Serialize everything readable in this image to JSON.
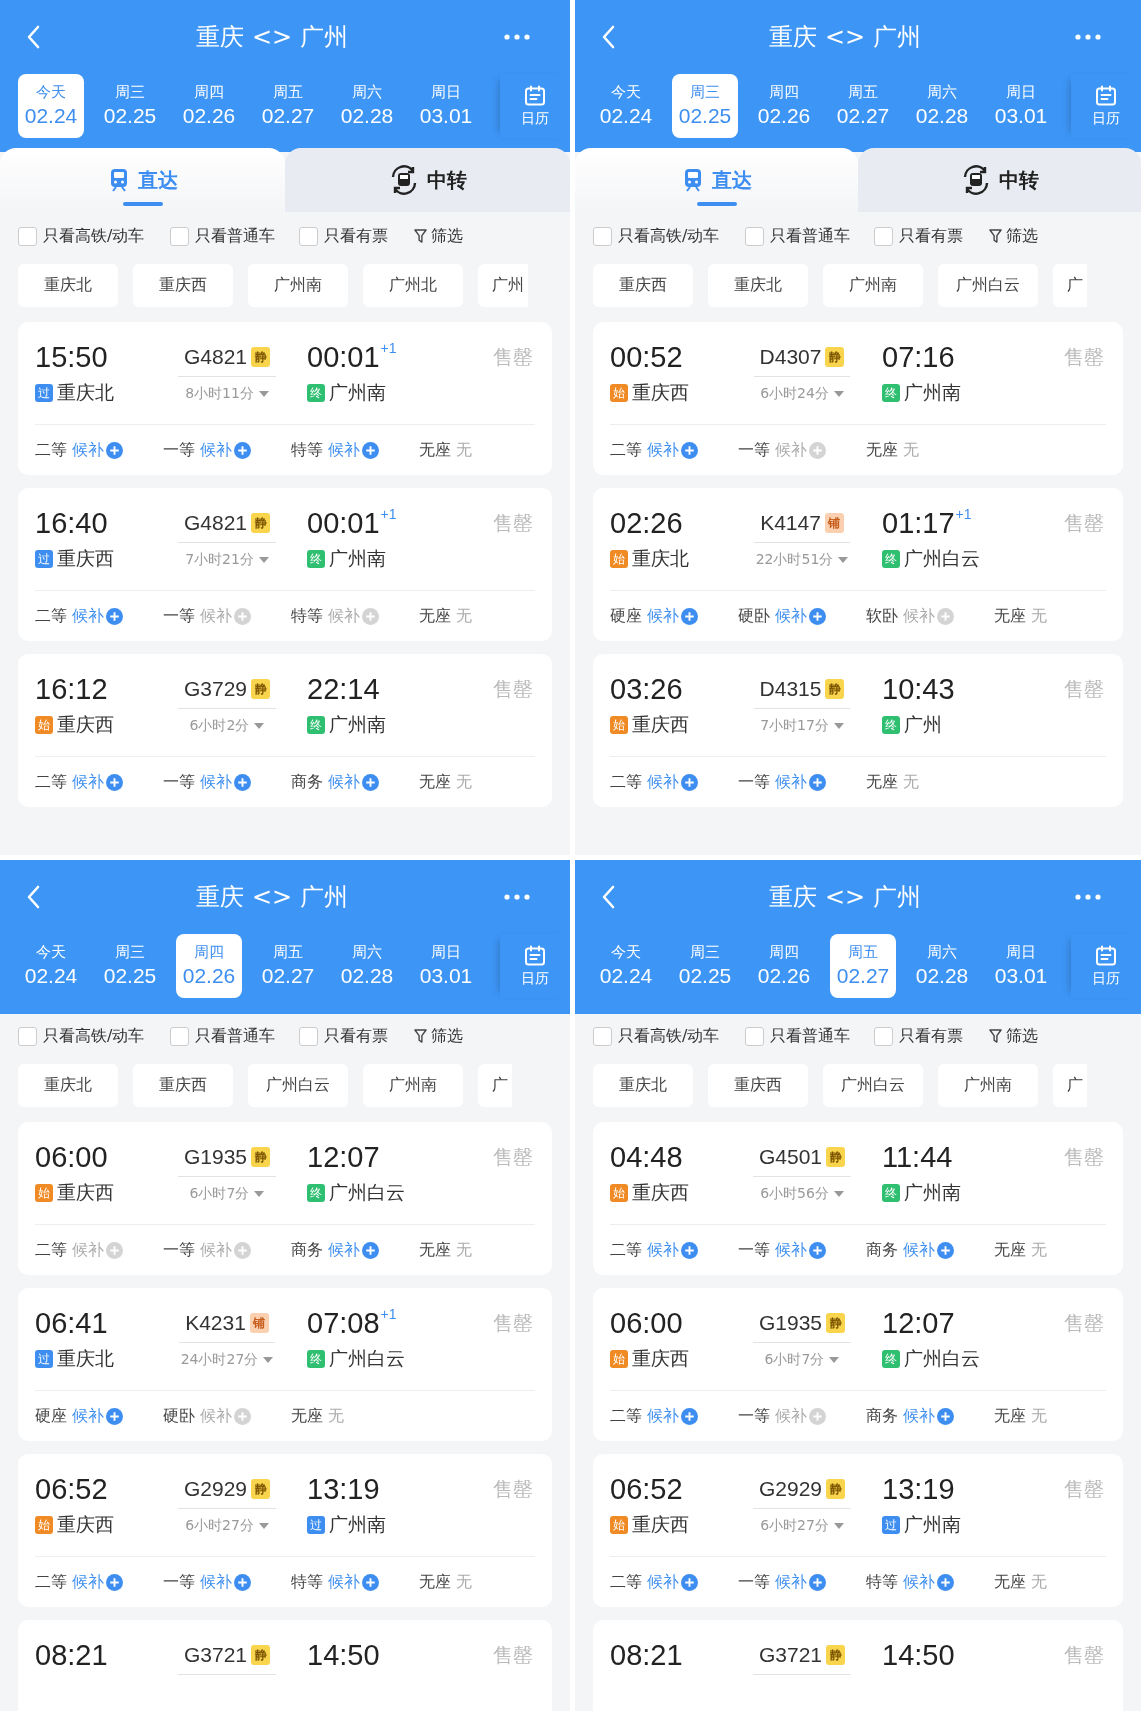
{
  "panels": [
    {
      "title": "重庆 <> 广州",
      "dates": [
        {
          "weekday": "今天",
          "date": "02.24",
          "selected": true
        },
        {
          "weekday": "周三",
          "date": "02.25",
          "selected": false
        },
        {
          "weekday": "周四",
          "date": "02.26",
          "selected": false
        },
        {
          "weekday": "周五",
          "date": "02.27",
          "selected": false
        },
        {
          "weekday": "周六",
          "date": "02.28",
          "selected": false
        },
        {
          "weekday": "周日",
          "date": "03.01",
          "selected": false
        }
      ],
      "calendar": "日历",
      "tabs": [
        {
          "label": "直达",
          "kind": "direct",
          "selected": true
        },
        {
          "label": "中转",
          "kind": "transfer",
          "selected": false
        }
      ],
      "filters": [
        {
          "label": "只看高铁/动车",
          "checked": false
        },
        {
          "label": "只看普通车",
          "checked": false
        },
        {
          "label": "只看有票",
          "checked": false
        }
      ],
      "filter_button": "筛选",
      "stations": [
        {
          "label": "重庆北"
        },
        {
          "label": "重庆西"
        },
        {
          "label": "广州南"
        },
        {
          "label": "广州北"
        },
        {
          "label": "广州",
          "cut": true
        }
      ],
      "trains": [
        {
          "depart": "15:50",
          "train": "G4821",
          "tag": {
            "text": "静",
            "kind": "quiet"
          },
          "arrive": "00:01",
          "next_day": "+1",
          "status": "售罄",
          "from": {
            "marker": "过",
            "kind": "pass",
            "name": "重庆北"
          },
          "duration": "8小时11分",
          "to": {
            "marker": "终",
            "kind": "end",
            "name": "广州南"
          },
          "seats": [
            {
              "class": "二等",
              "status": "候补",
              "kind": "waitlist",
              "available": true
            },
            {
              "class": "一等",
              "status": "候补",
              "kind": "waitlist",
              "available": true
            },
            {
              "class": "特等",
              "status": "候补",
              "kind": "waitlist",
              "available": true
            },
            {
              "class": "无座",
              "status": "无",
              "kind": "none"
            }
          ]
        },
        {
          "depart": "16:40",
          "train": "G4821",
          "tag": {
            "text": "静",
            "kind": "quiet"
          },
          "arrive": "00:01",
          "next_day": "+1",
          "status": "售罄",
          "from": {
            "marker": "过",
            "kind": "pass",
            "name": "重庆西"
          },
          "duration": "7小时21分",
          "to": {
            "marker": "终",
            "kind": "end",
            "name": "广州南"
          },
          "seats": [
            {
              "class": "二等",
              "status": "候补",
              "kind": "waitlist",
              "available": true
            },
            {
              "class": "一等",
              "status": "候补",
              "kind": "waitlist",
              "available": false
            },
            {
              "class": "特等",
              "status": "候补",
              "kind": "waitlist",
              "available": false
            },
            {
              "class": "无座",
              "status": "无",
              "kind": "none"
            }
          ]
        },
        {
          "depart": "16:12",
          "train": "G3729",
          "tag": {
            "text": "静",
            "kind": "quiet"
          },
          "arrive": "22:14",
          "status": "售罄",
          "from": {
            "marker": "始",
            "kind": "start",
            "name": "重庆西"
          },
          "duration": "6小时2分",
          "to": {
            "marker": "终",
            "kind": "end",
            "name": "广州南"
          },
          "seats": [
            {
              "class": "二等",
              "status": "候补",
              "kind": "waitlist",
              "available": true
            },
            {
              "class": "一等",
              "status": "候补",
              "kind": "waitlist",
              "available": true
            },
            {
              "class": "商务",
              "status": "候补",
              "kind": "waitlist",
              "available": true
            },
            {
              "class": "无座",
              "status": "无",
              "kind": "none"
            }
          ]
        }
      ]
    },
    {
      "title": "重庆 <> 广州",
      "dates": [
        {
          "weekday": "今天",
          "date": "02.24",
          "selected": false
        },
        {
          "weekday": "周三",
          "date": "02.25",
          "selected": true
        },
        {
          "weekday": "周四",
          "date": "02.26",
          "selected": false
        },
        {
          "weekday": "周五",
          "date": "02.27",
          "selected": false
        },
        {
          "weekday": "周六",
          "date": "02.28",
          "selected": false
        },
        {
          "weekday": "周日",
          "date": "03.01",
          "selected": false
        }
      ],
      "calendar": "日历",
      "tabs": [
        {
          "label": "直达",
          "kind": "direct",
          "selected": true
        },
        {
          "label": "中转",
          "kind": "transfer",
          "selected": false
        }
      ],
      "filters": [
        {
          "label": "只看高铁/动车",
          "checked": false
        },
        {
          "label": "只看普通车",
          "checked": false
        },
        {
          "label": "只看有票",
          "checked": false
        }
      ],
      "filter_button": "筛选",
      "stations": [
        {
          "label": "重庆西"
        },
        {
          "label": "重庆北"
        },
        {
          "label": "广州南"
        },
        {
          "label": "广州白云"
        },
        {
          "label": "广",
          "cut": true
        }
      ],
      "trains": [
        {
          "depart": "00:52",
          "train": "D4307",
          "tag": {
            "text": "静",
            "kind": "quiet"
          },
          "arrive": "07:16",
          "status": "售罄",
          "from": {
            "marker": "始",
            "kind": "start",
            "name": "重庆西"
          },
          "duration": "6小时24分",
          "to": {
            "marker": "终",
            "kind": "end",
            "name": "广州南"
          },
          "seats": [
            {
              "class": "二等",
              "status": "候补",
              "kind": "waitlist",
              "available": true
            },
            {
              "class": "一等",
              "status": "候补",
              "kind": "waitlist",
              "available": false
            },
            {
              "class": "无座",
              "status": "无",
              "kind": "none"
            }
          ]
        },
        {
          "depart": "02:26",
          "train": "K4147",
          "tag": {
            "text": "铺",
            "kind": "sleeper"
          },
          "arrive": "01:17",
          "next_day": "+1",
          "status": "售罄",
          "from": {
            "marker": "始",
            "kind": "start",
            "name": "重庆北"
          },
          "duration": "22小时51分",
          "to": {
            "marker": "终",
            "kind": "end",
            "name": "广州白云"
          },
          "seats": [
            {
              "class": "硬座",
              "status": "候补",
              "kind": "waitlist",
              "available": true
            },
            {
              "class": "硬卧",
              "status": "候补",
              "kind": "waitlist",
              "available": true
            },
            {
              "class": "软卧",
              "status": "候补",
              "kind": "waitlist",
              "available": false
            },
            {
              "class": "无座",
              "status": "无",
              "kind": "none"
            }
          ]
        },
        {
          "depart": "03:26",
          "train": "D4315",
          "tag": {
            "text": "静",
            "kind": "quiet"
          },
          "arrive": "10:43",
          "status": "售罄",
          "from": {
            "marker": "始",
            "kind": "start",
            "name": "重庆西"
          },
          "duration": "7小时17分",
          "to": {
            "marker": "终",
            "kind": "end",
            "name": "广州"
          },
          "seats": [
            {
              "class": "二等",
              "status": "候补",
              "kind": "waitlist",
              "available": true
            },
            {
              "class": "一等",
              "status": "候补",
              "kind": "waitlist",
              "available": true
            },
            {
              "class": "无座",
              "status": "无",
              "kind": "none"
            }
          ]
        }
      ]
    },
    {
      "title": "重庆 <> 广州",
      "dates": [
        {
          "weekday": "今天",
          "date": "02.24",
          "selected": false
        },
        {
          "weekday": "周三",
          "date": "02.25",
          "selected": false
        },
        {
          "weekday": "周四",
          "date": "02.26",
          "selected": true
        },
        {
          "weekday": "周五",
          "date": "02.27",
          "selected": false
        },
        {
          "weekday": "周六",
          "date": "02.28",
          "selected": false
        },
        {
          "weekday": "周日",
          "date": "03.01",
          "selected": false
        }
      ],
      "calendar": "日历",
      "filters": [
        {
          "label": "只看高铁/动车",
          "checked": false
        },
        {
          "label": "只看普通车",
          "checked": false
        },
        {
          "label": "只看有票",
          "checked": false
        }
      ],
      "filter_button": "筛选",
      "stations": [
        {
          "label": "重庆北"
        },
        {
          "label": "重庆西"
        },
        {
          "label": "广州白云"
        },
        {
          "label": "广州南"
        },
        {
          "label": "广",
          "cut": true
        }
      ],
      "trains": [
        {
          "depart": "06:00",
          "train": "G1935",
          "tag": {
            "text": "静",
            "kind": "quiet"
          },
          "arrive": "12:07",
          "status": "售罄",
          "from": {
            "marker": "始",
            "kind": "start",
            "name": "重庆西"
          },
          "duration": "6小时7分",
          "to": {
            "marker": "终",
            "kind": "end",
            "name": "广州白云"
          },
          "seats": [
            {
              "class": "二等",
              "status": "候补",
              "kind": "waitlist",
              "available": false
            },
            {
              "class": "一等",
              "status": "候补",
              "kind": "waitlist",
              "available": false
            },
            {
              "class": "商务",
              "status": "候补",
              "kind": "waitlist",
              "available": true
            },
            {
              "class": "无座",
              "status": "无",
              "kind": "none"
            }
          ]
        },
        {
          "depart": "06:41",
          "train": "K4231",
          "tag": {
            "text": "铺",
            "kind": "sleeper"
          },
          "arrive": "07:08",
          "next_day": "+1",
          "status": "售罄",
          "from": {
            "marker": "过",
            "kind": "pass",
            "name": "重庆北"
          },
          "duration": "24小时27分",
          "to": {
            "marker": "终",
            "kind": "end",
            "name": "广州白云"
          },
          "seats": [
            {
              "class": "硬座",
              "status": "候补",
              "kind": "waitlist",
              "available": true
            },
            {
              "class": "硬卧",
              "status": "候补",
              "kind": "waitlist",
              "available": false
            },
            {
              "class": "无座",
              "status": "无",
              "kind": "none"
            }
          ]
        },
        {
          "depart": "06:52",
          "train": "G2929",
          "tag": {
            "text": "静",
            "kind": "quiet"
          },
          "arrive": "13:19",
          "status": "售罄",
          "from": {
            "marker": "始",
            "kind": "start",
            "name": "重庆西"
          },
          "duration": "6小时27分",
          "to": {
            "marker": "过",
            "kind": "pass",
            "name": "广州南"
          },
          "seats": [
            {
              "class": "二等",
              "status": "候补",
              "kind": "waitlist",
              "available": true
            },
            {
              "class": "一等",
              "status": "候补",
              "kind": "waitlist",
              "available": true
            },
            {
              "class": "特等",
              "status": "候补",
              "kind": "waitlist",
              "available": true
            },
            {
              "class": "无座",
              "status": "无",
              "kind": "none"
            }
          ]
        },
        {
          "depart": "08:21",
          "train": "G3721",
          "tag": {
            "text": "静",
            "kind": "quiet"
          },
          "arrive": "14:50",
          "status": "售罄"
        }
      ]
    },
    {
      "title": "重庆 <> 广州",
      "dates": [
        {
          "weekday": "今天",
          "date": "02.24",
          "selected": false
        },
        {
          "weekday": "周三",
          "date": "02.25",
          "selected": false
        },
        {
          "weekday": "周四",
          "date": "02.26",
          "selected": false
        },
        {
          "weekday": "周五",
          "date": "02.27",
          "selected": true
        },
        {
          "weekday": "周六",
          "date": "02.28",
          "selected": false
        },
        {
          "weekday": "周日",
          "date": "03.01",
          "selected": false
        }
      ],
      "calendar": "日历",
      "filters": [
        {
          "label": "只看高铁/动车",
          "checked": false
        },
        {
          "label": "只看普通车",
          "checked": false
        },
        {
          "label": "只看有票",
          "checked": false
        }
      ],
      "filter_button": "筛选",
      "stations": [
        {
          "label": "重庆北"
        },
        {
          "label": "重庆西"
        },
        {
          "label": "广州白云"
        },
        {
          "label": "广州南"
        },
        {
          "label": "广",
          "cut": true
        }
      ],
      "trains": [
        {
          "depart": "04:48",
          "train": "G4501",
          "tag": {
            "text": "静",
            "kind": "quiet"
          },
          "arrive": "11:44",
          "status": "售罄",
          "from": {
            "marker": "始",
            "kind": "start",
            "name": "重庆西"
          },
          "duration": "6小时56分",
          "to": {
            "marker": "终",
            "kind": "end",
            "name": "广州南"
          },
          "seats": [
            {
              "class": "二等",
              "status": "候补",
              "kind": "waitlist",
              "available": true
            },
            {
              "class": "一等",
              "status": "候补",
              "kind": "waitlist",
              "available": true
            },
            {
              "class": "商务",
              "status": "候补",
              "kind": "waitlist",
              "available": true
            },
            {
              "class": "无座",
              "status": "无",
              "kind": "none"
            }
          ]
        },
        {
          "depart": "06:00",
          "train": "G1935",
          "tag": {
            "text": "静",
            "kind": "quiet"
          },
          "arrive": "12:07",
          "status": "售罄",
          "from": {
            "marker": "始",
            "kind": "start",
            "name": "重庆西"
          },
          "duration": "6小时7分",
          "to": {
            "marker": "终",
            "kind": "end",
            "name": "广州白云"
          },
          "seats": [
            {
              "class": "二等",
              "status": "候补",
              "kind": "waitlist",
              "available": true
            },
            {
              "class": "一等",
              "status": "候补",
              "kind": "waitlist",
              "available": false
            },
            {
              "class": "商务",
              "status": "候补",
              "kind": "waitlist",
              "available": true
            },
            {
              "class": "无座",
              "status": "无",
              "kind": "none"
            }
          ]
        },
        {
          "depart": "06:52",
          "train": "G2929",
          "tag": {
            "text": "静",
            "kind": "quiet"
          },
          "arrive": "13:19",
          "status": "售罄",
          "from": {
            "marker": "始",
            "kind": "start",
            "name": "重庆西"
          },
          "duration": "6小时27分",
          "to": {
            "marker": "过",
            "kind": "pass",
            "name": "广州南"
          },
          "seats": [
            {
              "class": "二等",
              "status": "候补",
              "kind": "waitlist",
              "available": true
            },
            {
              "class": "一等",
              "status": "候补",
              "kind": "waitlist",
              "available": true
            },
            {
              "class": "特等",
              "status": "候补",
              "kind": "waitlist",
              "available": true
            },
            {
              "class": "无座",
              "status": "无",
              "kind": "none"
            }
          ]
        },
        {
          "depart": "08:21",
          "train": "G3721",
          "tag": {
            "text": "静",
            "kind": "quiet"
          },
          "arrive": "14:50",
          "status": "售罄"
        }
      ]
    }
  ]
}
